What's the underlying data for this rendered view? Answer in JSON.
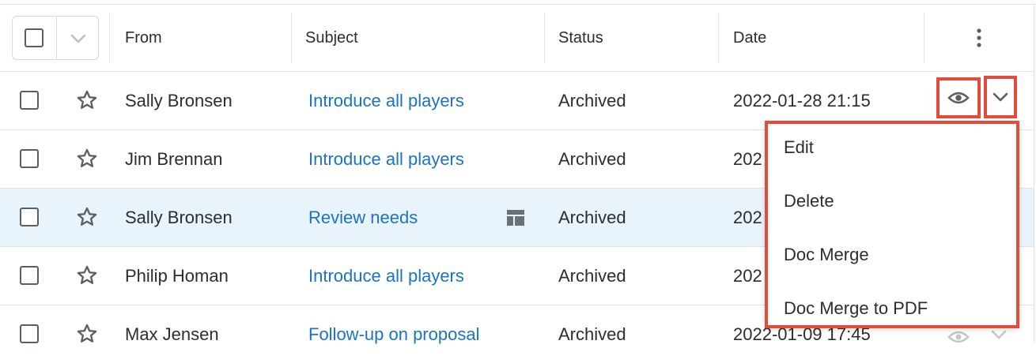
{
  "header": {
    "from": "From",
    "subject": "Subject",
    "status": "Status",
    "date": "Date"
  },
  "rows": [
    {
      "from": "Sally Bronsen",
      "subject": "Introduce all players",
      "status": "Archived",
      "date": "2022-01-28 21:15"
    },
    {
      "from": "Jim Brennan",
      "subject": "Introduce all players",
      "status": "Archived",
      "date": "202"
    },
    {
      "from": "Sally Bronsen",
      "subject": "Review needs",
      "status": "Archived",
      "date": "202"
    },
    {
      "from": "Philip Homan",
      "subject": "Introduce all players",
      "status": "Archived",
      "date": "202"
    },
    {
      "from": "Max Jensen",
      "subject": "Follow-up on proposal",
      "status": "Archived",
      "date": "2022-01-09 17:45"
    }
  ],
  "menu": {
    "items": [
      "Edit",
      "Delete",
      "Doc Merge",
      "Doc Merge to PDF"
    ]
  },
  "icons": {
    "star": "star-outline-icon",
    "eye": "eye-icon",
    "chevron": "chevron-down-icon",
    "kebab": "kebab-menu-icon",
    "layout": "record-layout-icon"
  },
  "colors": {
    "link": "#1a73c5",
    "highlight_row": "#e8f3fc",
    "annotation": "#e34b3a"
  }
}
